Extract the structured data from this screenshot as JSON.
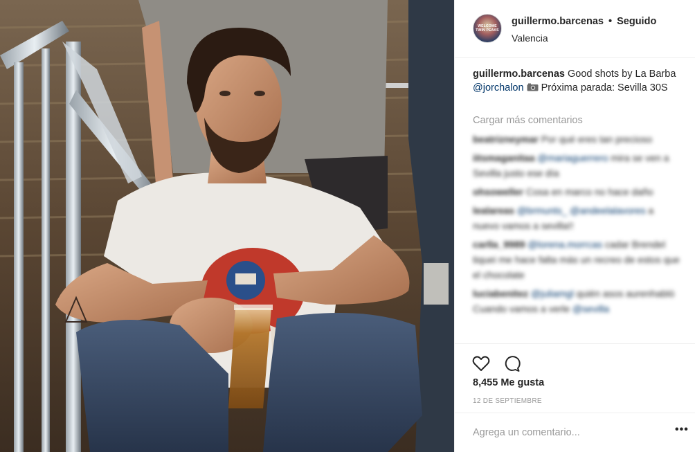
{
  "post": {
    "username": "guillermo.barcenas",
    "separator": "•",
    "follow_status": "Seguido",
    "location": "Valencia",
    "avatar_text": "WELCOME TWIN PEAKS",
    "caption": {
      "username": "guillermo.barcenas",
      "text_before": "Good shots by La Barba",
      "mention": "@jorchalon",
      "camera_icon": "camera-icon",
      "text_after": "Próxima parada: Sevilla 30S"
    },
    "load_more_label": "Cargar más comentarios",
    "comments": [
      {
        "user": "beatrizneymar",
        "text": "Por qué eres tan precioso"
      },
      {
        "user": "iitsmaganitaa",
        "mention": "@mariaguerrero",
        "text": "mira se ven a Sevilla justo ese día"
      },
      {
        "user": "ohsoweller",
        "text": "Cosa en marco no hace daño"
      },
      {
        "user": "lealareas",
        "mention": "@brmunts_ @andeelalavores",
        "text": "a nuevo vamos a sevilla!!"
      },
      {
        "user": "carlla_9989",
        "mention": "@lorena.morrcas",
        "text": "cadar Brendel tiquei me hace falta más un recreo de estos que el chocolate"
      },
      {
        "user": "luciabenitez",
        "mention": "@juliamgl",
        "text": "quién asos aurenhabló Cuando vamos a verle",
        "mention2": "@sevilla"
      }
    ],
    "actions": {
      "like_icon": "heart-icon",
      "comment_icon": "comment-bubble-icon"
    },
    "likes_label": "8,455 Me gusta",
    "date": "12 DE SEPTIEMBRE",
    "add_comment_placeholder": "Agrega un comentario...",
    "more_label": "•••"
  }
}
